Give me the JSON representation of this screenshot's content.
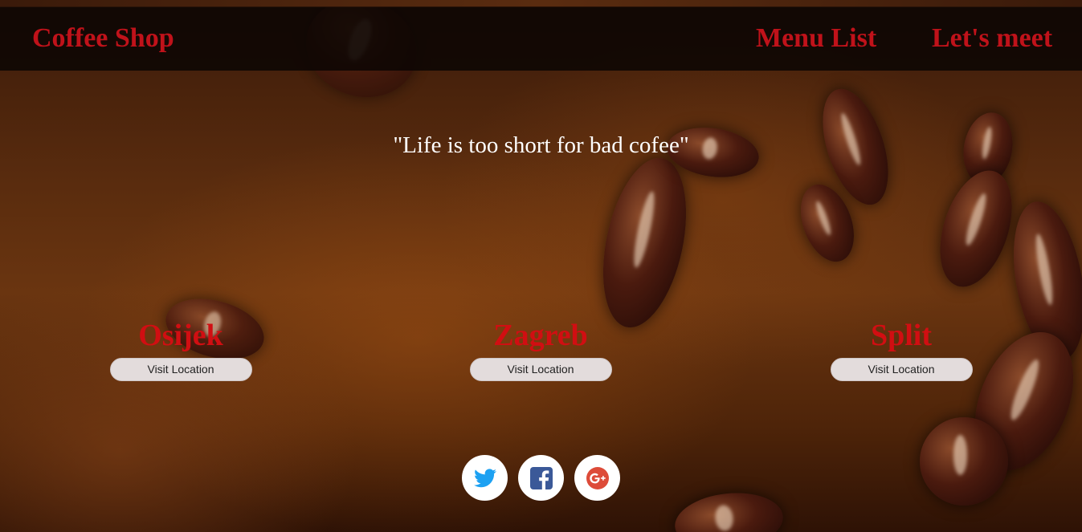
{
  "header": {
    "brand": "Coffee Shop",
    "nav": [
      {
        "label": "Menu List"
      },
      {
        "label": "Let's meet"
      }
    ]
  },
  "hero": {
    "quote": "\"Life is too short for bad cofee\""
  },
  "locations": [
    {
      "city": "Osijek",
      "button": "Visit Location"
    },
    {
      "city": "Zagreb",
      "button": "Visit Location"
    },
    {
      "city": "Split",
      "button": "Visit Location"
    }
  ],
  "social": [
    {
      "icon": "twitter-icon",
      "color": "#1da1f2"
    },
    {
      "icon": "facebook-icon",
      "color": "#3b5998"
    },
    {
      "icon": "google-plus-icon",
      "color": "#dd4b39"
    }
  ],
  "colors": {
    "accent": "#c0121a",
    "quote_text": "#ffffff",
    "button_bg": "#e3dcdc"
  }
}
